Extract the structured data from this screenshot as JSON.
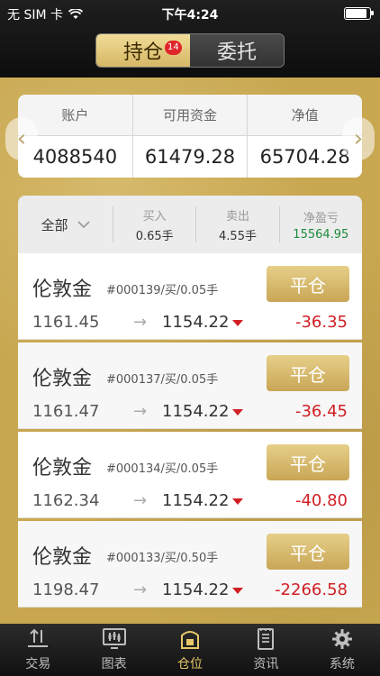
{
  "status_bar": {
    "carrier": "无 SIM 卡",
    "time": "下午4:24",
    "battery_level": 0.9
  },
  "header": {
    "tabs": [
      {
        "label": "持仓",
        "badge": "14",
        "active": true
      },
      {
        "label": "委托",
        "active": false
      }
    ]
  },
  "account": {
    "headers": [
      "账户",
      "可用资金",
      "净值"
    ],
    "values": [
      "4088540",
      "61479.28",
      "65704.28"
    ]
  },
  "nav_arrows": {
    "left": "‹",
    "right": "›"
  },
  "summary": {
    "filter_label": "全部",
    "buy_label": "买入",
    "buy_value": "0.65手",
    "sell_label": "卖出",
    "sell_value": "4.55手",
    "pnl_label": "净盈亏",
    "pnl_value": "15564.95"
  },
  "positions": [
    {
      "name": "伦敦金",
      "order": "#000139/买/0.05手",
      "close_label": "平仓",
      "open_price": "1161.45",
      "arrow": "→",
      "current_price": "1154.22",
      "pnl": "-36.35"
    },
    {
      "name": "伦敦金",
      "order": "#000137/买/0.05手",
      "close_label": "平仓",
      "open_price": "1161.47",
      "arrow": "→",
      "current_price": "1154.22",
      "pnl": "-36.45"
    },
    {
      "name": "伦敦金",
      "order": "#000134/买/0.05手",
      "close_label": "平仓",
      "open_price": "1162.34",
      "arrow": "→",
      "current_price": "1154.22",
      "pnl": "-40.80"
    },
    {
      "name": "伦敦金",
      "order": "#000133/买/0.50手",
      "close_label": "平仓",
      "open_price": "1198.47",
      "arrow": "→",
      "current_price": "1154.22",
      "pnl": "-2266.58"
    }
  ],
  "tabbar": {
    "items": [
      {
        "label": "交易",
        "icon": "trade-icon",
        "active": false
      },
      {
        "label": "图表",
        "icon": "chart-icon",
        "active": false
      },
      {
        "label": "仓位",
        "icon": "position-icon",
        "active": true
      },
      {
        "label": "资讯",
        "icon": "news-icon",
        "active": false
      },
      {
        "label": "系统",
        "icon": "settings-icon",
        "active": false
      }
    ]
  },
  "colors": {
    "gold": "#c8a750",
    "loss_red": "#d11f24",
    "profit_green": "#1e8a3c",
    "active_tab": "#e8c86a"
  }
}
